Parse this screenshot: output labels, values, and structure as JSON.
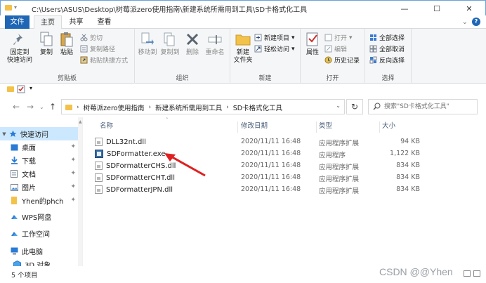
{
  "window": {
    "title": "C:\\Users\\ASUS\\Desktop\\树莓派zero使用指南\\新建系统所需用到工具\\SD卡格式化工具",
    "controls": {
      "minimize": "—",
      "maximize": "☐",
      "close": "✕"
    }
  },
  "tabs": {
    "file": "文件",
    "home": "主页",
    "share": "共享",
    "view": "查看"
  },
  "ribbon": {
    "clipboard": {
      "label": "剪贴板",
      "pin": "固定到\n快速访问",
      "copy": "复制",
      "paste": "粘贴",
      "cut": "剪切",
      "copy_path": "复制路径",
      "paste_shortcut": "粘贴快捷方式"
    },
    "organize": {
      "label": "组织",
      "move_to": "移动到",
      "copy_to": "复制到",
      "delete": "删除",
      "rename": "重命名"
    },
    "new": {
      "label": "新建",
      "new_folder": "新建\n文件夹",
      "new_item": "新建项目",
      "easy_access": "轻松访问"
    },
    "open": {
      "label": "打开",
      "properties": "属性",
      "open": "打开",
      "edit": "编辑",
      "history": "历史记录"
    },
    "select": {
      "label": "选择",
      "select_all": "全部选择",
      "select_none": "全部取消",
      "invert": "反向选择"
    }
  },
  "address": {
    "crumbs": [
      "树莓派zero使用指南",
      "新建系统所需用到工具",
      "SD卡格式化工具"
    ]
  },
  "search": {
    "placeholder": "搜索\"SD卡格式化工具\""
  },
  "nav": {
    "items": [
      {
        "label": "快速访问",
        "pinned": false
      },
      {
        "label": "桌面",
        "pinned": true
      },
      {
        "label": "下载",
        "pinned": true
      },
      {
        "label": "文档",
        "pinned": true
      },
      {
        "label": "图片",
        "pinned": true
      },
      {
        "label": "Yhen的phch",
        "pinned": true
      },
      {
        "label": "WPS网盘",
        "pinned": false
      },
      {
        "label": "工作空间",
        "pinned": false
      },
      {
        "label": "此电脑",
        "pinned": false
      },
      {
        "label": "3D 对象",
        "pinned": false
      }
    ]
  },
  "columns": {
    "name": "名称",
    "date": "修改日期",
    "type": "类型",
    "size": "大小"
  },
  "files": [
    {
      "name": "DLL32nt.dll",
      "date": "2020/11/11 16:48",
      "type": "应用程序扩展",
      "size": "94 KB",
      "icon": "dll-icon"
    },
    {
      "name": "SDFormatter.exe",
      "date": "2020/11/11 16:48",
      "type": "应用程序",
      "size": "1,122 KB",
      "icon": "exe-icon"
    },
    {
      "name": "SDFormatterCHS.dll",
      "date": "2020/11/11 16:48",
      "type": "应用程序扩展",
      "size": "834 KB",
      "icon": "dll-icon"
    },
    {
      "name": "SDFormatterCHT.dll",
      "date": "2020/11/11 16:48",
      "type": "应用程序扩展",
      "size": "834 KB",
      "icon": "dll-icon"
    },
    {
      "name": "SDFormatterJPN.dll",
      "date": "2020/11/11 16:48",
      "type": "应用程序扩展",
      "size": "834 KB",
      "icon": "dll-icon"
    }
  ],
  "status": {
    "count": "5 个项目"
  },
  "watermark": "CSDN @@Yhen",
  "colors": {
    "accent": "#1f66b5",
    "selection": "#cce8ff",
    "annotation_arrow": "#e02020"
  }
}
